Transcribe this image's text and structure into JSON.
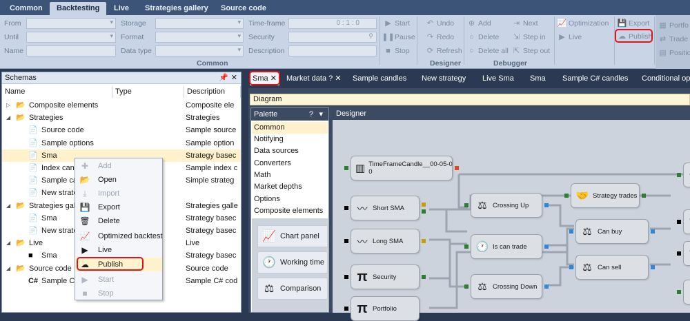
{
  "ribbon_tabs": [
    "Common",
    "Backtesting",
    "Live",
    "Strategies gallery",
    "Source code"
  ],
  "ribbon": {
    "fields_left": {
      "from": "From",
      "until": "Until",
      "name": "Name"
    },
    "fields_mid": {
      "storage": "Storage",
      "format": "Format",
      "data_type": "Data type"
    },
    "fields_right": {
      "timeframe": "Time-frame",
      "timeframe_value": "0 : 1 : 0",
      "security": "Security",
      "description": "Description"
    },
    "common_group": "Common",
    "run_buttons": {
      "start": "Start",
      "pause": "Pause",
      "stop": "Stop"
    },
    "designer_buttons": {
      "undo": "Undo",
      "redo": "Redo",
      "refresh": "Refresh"
    },
    "designer_group": "Designer",
    "debug_buttons": {
      "add": "Add",
      "delete": "Delete",
      "delete_all": "Delete all",
      "next": "Next",
      "step_in": "Step in",
      "step_out": "Step out"
    },
    "debugger_group": "Debugger",
    "opt_buttons": {
      "optimization": "Optimization",
      "live": "Live"
    },
    "export_buttons": {
      "export": "Export",
      "publish": "Publish"
    },
    "extra_buttons": {
      "portfolio": "Portfo",
      "trades": "Trade",
      "positions": "Positio"
    }
  },
  "schemas": {
    "title": "Schemas",
    "columns": {
      "name": "Name",
      "type": "Type",
      "description": "Description"
    },
    "rows": [
      {
        "name": "Composite elements",
        "desc": "Composite ele"
      },
      {
        "name": "Strategies",
        "desc": "Strategies"
      },
      {
        "name": "Source code",
        "desc": "Sample source"
      },
      {
        "name": "Sample options",
        "desc": "Sample option"
      },
      {
        "name": "Sma",
        "desc": "Strategy basec"
      },
      {
        "name": "Index cand",
        "desc": "Sample index c"
      },
      {
        "name": "Sample ca",
        "desc": "Simple strateg"
      },
      {
        "name": "New strate",
        "desc": ""
      },
      {
        "name": "Strategies gall",
        "desc": "Strategies galle"
      },
      {
        "name": "Sma",
        "desc": "Strategy basec"
      },
      {
        "name": "New strate",
        "desc": "Strategy basec"
      },
      {
        "name": "Live",
        "desc": "Live"
      },
      {
        "name": "Sma",
        "desc": "Strategy basec"
      },
      {
        "name": "Source code",
        "desc": "Source code"
      },
      {
        "name": "Sample C#",
        "desc": "Sample C# cod"
      }
    ]
  },
  "context_menu": {
    "add": "Add",
    "open": "Open",
    "import": "Import",
    "export": "Export",
    "delete": "Delete",
    "optimized_backtest": "Optimized backtest",
    "live": "Live",
    "publish": "Publish",
    "start": "Start",
    "stop": "Stop"
  },
  "doc_tabs": [
    "Sma",
    "Market data",
    "Sample candles",
    "New strategy",
    "Live Sma",
    "Sma",
    "Sample C# candles",
    "Conditional ope"
  ],
  "diagram_title": "Diagram",
  "palette": {
    "title": "Palette",
    "categories": [
      "Common",
      "Notifying",
      "Data sources",
      "Converters",
      "Math",
      "Market depths",
      "Options",
      "Composite elements"
    ],
    "tools": [
      "Chart panel",
      "Working time",
      "Comparison"
    ]
  },
  "designer": {
    "title": "Designer",
    "nodes": {
      "timeframe": "TimeFrameCandle__00-05-0\n0",
      "short_sma": "Short SMA",
      "long_sma": "Long SMA",
      "security": "Security",
      "portfolio": "Portfolio",
      "crossing_up": "Crossing Up",
      "is_can_trade": "Is can trade",
      "crossing_down": "Crossing Down",
      "strategy_trades": "Strategy trades",
      "can_buy": "Can buy",
      "can_sell": "Can sell"
    }
  },
  "colors": {
    "tabbar": "#3c5478",
    "ribbon": "#c9d5e6",
    "highlight": "#e0141e",
    "selection": "#fff2cc",
    "dark": "#2b3a52"
  }
}
